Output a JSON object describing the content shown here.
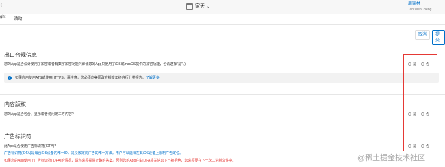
{
  "topbar": {
    "app_name": "家天",
    "user_name": "周家林",
    "user_sub": "Tan WenCheng"
  },
  "tabs": [
    {
      "label": "ght"
    },
    {
      "label": "活动"
    }
  ],
  "actions": {
    "cancel_label": "取消",
    "submit_label": "提交"
  },
  "sections": [
    {
      "title": "出口合规信息",
      "question": "您的App是否设计使用了加密或者有数字加密功能?(即便您的App只使用了iOS或macOS提供的加密功能，也请选择\"是\"。)",
      "options": {
        "yes": "是",
        "no": "否"
      },
      "selected": "no",
      "info": {
        "text": "如果应用使用ATS或使用HTTPS，请注意，您必须向美国政府提交年终自行分类报告。",
        "link": "了解更多"
      }
    },
    {
      "title": "内容版权",
      "question": "您的App是否包含、显示或者访问第三方内容?",
      "options": {
        "yes": "是",
        "no": "否"
      },
      "selected": "no"
    },
    {
      "title": "广告标识符",
      "question": "此App是否使用广告标识符(IDFA)?",
      "options": {
        "yes": "是",
        "no": "否"
      },
      "selected": "no",
      "note_blue": "广告标识符(IDFA)是每台iOS设备的唯一ID，是投放定向广告的唯一方法。用户可以选择在其iOS设备上限制广告定位。",
      "note_red": "如果您的App使用了广告标识符(IDFA)的情况，请您必须提供正确的答案。否则您的App在由IDFA相关信息下已被拒绝，您必须要在下一次二进制文件中。"
    }
  ],
  "watermark": "@稀土掘金技术社区"
}
